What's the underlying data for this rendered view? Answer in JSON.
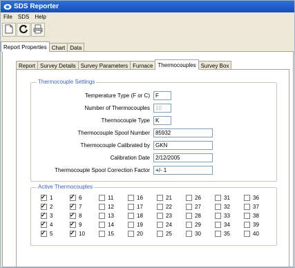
{
  "window": {
    "title": "SDS Reporter"
  },
  "menu": [
    "File",
    "SDS",
    "Help"
  ],
  "toolbar": {
    "buttons": [
      "new-doc-icon",
      "refresh-icon",
      "print-icon"
    ]
  },
  "main_tabs": [
    "Report Properties",
    "Chart",
    "Data"
  ],
  "sub_tabs": [
    "Report",
    "Survey Details",
    "Survey Parameters",
    "Furnace",
    "Thermocouples",
    "Survey Box"
  ],
  "settings": {
    "legend": "Thermocouple Settings",
    "fields": [
      {
        "label": "Temperature Type (F or C)",
        "value": "F",
        "disabled": false
      },
      {
        "label": "Number of Thermocouples",
        "value": "10",
        "disabled": true
      },
      {
        "label": "Thermocouple Type",
        "value": "K",
        "disabled": false
      },
      {
        "label": "Thermocouple Spool Number",
        "value": "85932",
        "disabled": false
      },
      {
        "label": "Thermocouple Calibrated by",
        "value": "GKN",
        "disabled": false
      },
      {
        "label": "Calibration Date",
        "value": "2/12/2005",
        "disabled": false
      },
      {
        "label": "Thermocouple Spool Correction Factor",
        "value": "+/- 1",
        "disabled": false
      }
    ]
  },
  "active": {
    "legend": "Active Thermocouples",
    "columns": [
      [
        {
          "n": "1",
          "c": true
        },
        {
          "n": "2",
          "c": true
        },
        {
          "n": "3",
          "c": true
        },
        {
          "n": "4",
          "c": true
        },
        {
          "n": "5",
          "c": true
        }
      ],
      [
        {
          "n": "6",
          "c": true
        },
        {
          "n": "7",
          "c": true
        },
        {
          "n": "8",
          "c": true
        },
        {
          "n": "9",
          "c": true
        },
        {
          "n": "10",
          "c": true
        }
      ],
      [
        {
          "n": "11",
          "c": false
        },
        {
          "n": "12",
          "c": false
        },
        {
          "n": "13",
          "c": false
        },
        {
          "n": "14",
          "c": false
        },
        {
          "n": "15",
          "c": false
        }
      ],
      [
        {
          "n": "16",
          "c": false
        },
        {
          "n": "17",
          "c": false
        },
        {
          "n": "18",
          "c": false
        },
        {
          "n": "19",
          "c": false
        },
        {
          "n": "20",
          "c": false
        }
      ],
      [
        {
          "n": "21",
          "c": false
        },
        {
          "n": "22",
          "c": false
        },
        {
          "n": "23",
          "c": false
        },
        {
          "n": "24",
          "c": false
        },
        {
          "n": "25",
          "c": false
        }
      ],
      [
        {
          "n": "26",
          "c": false
        },
        {
          "n": "27",
          "c": false
        },
        {
          "n": "28",
          "c": false
        },
        {
          "n": "29",
          "c": false
        },
        {
          "n": "30",
          "c": false
        }
      ],
      [
        {
          "n": "31",
          "c": false
        },
        {
          "n": "32",
          "c": false
        },
        {
          "n": "33",
          "c": false
        },
        {
          "n": "34",
          "c": false
        },
        {
          "n": "35",
          "c": false
        }
      ],
      [
        {
          "n": "36",
          "c": false
        },
        {
          "n": "37",
          "c": false
        },
        {
          "n": "38",
          "c": false
        },
        {
          "n": "39",
          "c": false
        },
        {
          "n": "40",
          "c": false
        }
      ]
    ]
  }
}
